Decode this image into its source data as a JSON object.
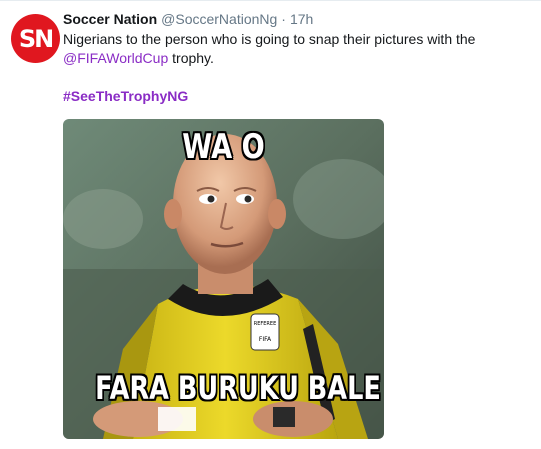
{
  "tweet": {
    "avatar_text": "SN",
    "display_name": "Soccer Nation",
    "handle": "@SoccerNationNg",
    "separator": "·",
    "time": "17h",
    "text_line1": "Nigerians to the person who is going to snap their pictures with the",
    "mention": "@FIFAWorldCup",
    "text_after_mention": " trophy.",
    "hashtag": "#SeeTheTrophyNG"
  },
  "media": {
    "caption_top": "WA O",
    "caption_bottom": "FARA BURUKU BALE",
    "badge_line1": "REFEREE",
    "badge_line2": "FIFA"
  },
  "colors": {
    "link": "#8a2cc5",
    "avatar_bg": "#e0171f",
    "jersey": "#e9d51a"
  }
}
